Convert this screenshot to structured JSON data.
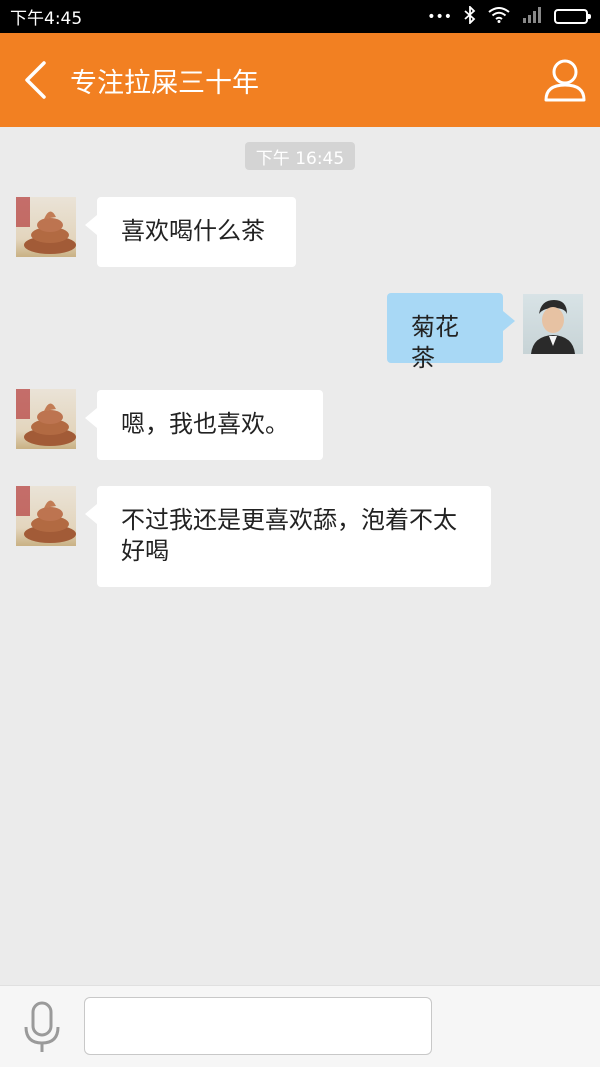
{
  "status_bar": {
    "time": "下午4:45",
    "icons": [
      "more-dots-icon",
      "bluetooth-icon",
      "wifi-icon",
      "signal-icon",
      "battery-icon"
    ]
  },
  "header": {
    "title": "专注拉屎三十年",
    "back_icon": "chevron-left-icon",
    "profile_icon": "person-icon"
  },
  "chat": {
    "timestamp": "下午 16:45",
    "messages": [
      {
        "side": "left",
        "avatar": "poop-avatar",
        "text": "喜欢喝什么茶"
      },
      {
        "side": "right",
        "avatar": "man-avatar",
        "text": "菊花茶"
      },
      {
        "side": "left",
        "avatar": "poop-avatar",
        "text": "嗯，我也喜欢。"
      },
      {
        "side": "left",
        "avatar": "poop-avatar",
        "text": "不过我还是更喜欢舔，泡着不太好喝"
      }
    ]
  },
  "input_bar": {
    "mic_icon": "microphone-icon",
    "value": "",
    "placeholder": ""
  },
  "colors": {
    "header": "#f28022",
    "chat_bg": "#ebebeb",
    "bubble_left": "#ffffff",
    "bubble_right": "#a8d8f5"
  }
}
